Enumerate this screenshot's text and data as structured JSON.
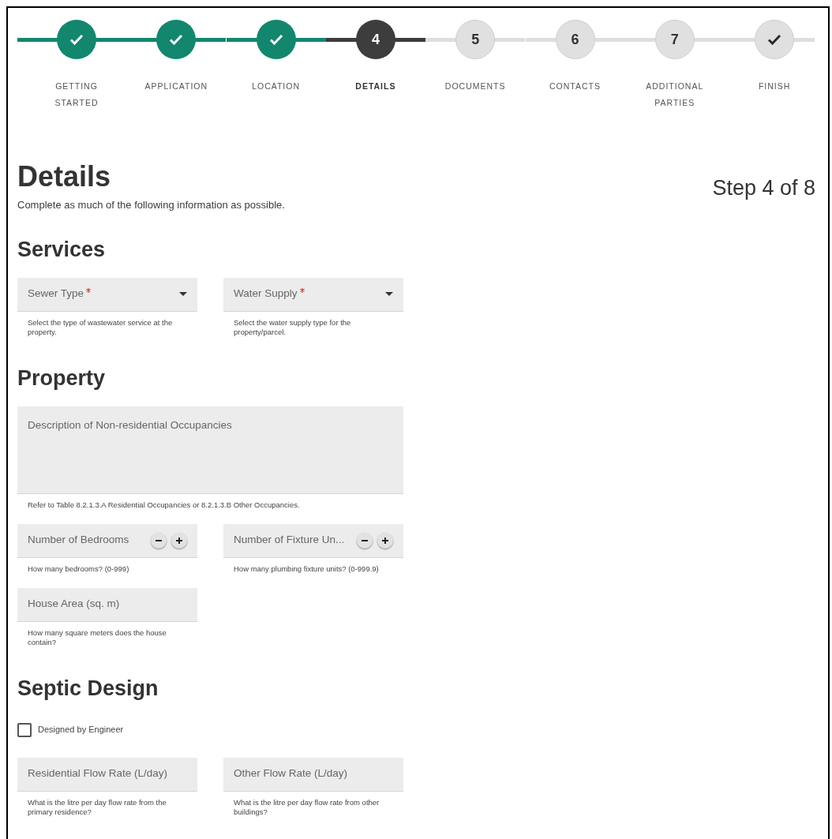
{
  "steps": [
    {
      "label": "GETTING STARTED",
      "completed": true,
      "selected": false
    },
    {
      "label": "APPLICATION",
      "completed": true,
      "selected": false
    },
    {
      "label": "LOCATION",
      "completed": true,
      "selected": false
    },
    {
      "label": "DETAILS",
      "completed": false,
      "selected": true,
      "number": "4"
    },
    {
      "label": "DOCUMENTS",
      "completed": false,
      "selected": false,
      "number": "5"
    },
    {
      "label": "CONTACTS",
      "completed": false,
      "selected": false,
      "number": "6"
    },
    {
      "label": "ADDITIONAL PARTIES",
      "completed": false,
      "selected": false,
      "number": "7"
    },
    {
      "label": "FINISH",
      "completed": false,
      "selected": false
    }
  ],
  "page": {
    "title": "Details",
    "subtitle": "Complete as much of the following information as possible.",
    "step_indicator": "Step 4 of 8"
  },
  "sections": [
    {
      "title": "Services",
      "fields": [
        {
          "kind": "select",
          "label": "Sewer Type",
          "required": true,
          "helper": "Select the type of wastewater service at the property."
        },
        {
          "kind": "select",
          "label": "Water Supply",
          "required": true,
          "helper": "Select the water supply type for the property/parcel."
        }
      ]
    },
    {
      "title": "Property",
      "fields": [
        {
          "kind": "textarea",
          "label": "Description of Non-residential Occupancies",
          "required": false,
          "helper": "Refer to Table 8.2.1.3.A Residential Occupancies or 8.2.1.3.B Other Occupancies."
        },
        {
          "kind": "number",
          "label": "Number of Bedrooms",
          "required": false,
          "helper": "How many bedrooms? (0-999)"
        },
        {
          "kind": "number",
          "label": "Number of Fixture Un...",
          "required": false,
          "helper": "How many plumbing fixture units? (0-999.9)"
        },
        {
          "kind": "text",
          "label": "House Area (sq. m)",
          "required": false,
          "helper": "How many square meters does the house contain?"
        }
      ]
    },
    {
      "title": "Septic Design",
      "fields": [
        {
          "kind": "checkbox",
          "label": "Designed by Engineer",
          "checked": false
        },
        {
          "kind": "text",
          "label": "Residential Flow Rate (L/day)",
          "required": false,
          "helper": "What is the litre per day flow rate from the primary residence?"
        },
        {
          "kind": "text",
          "label": "Other Flow Rate (L/day)",
          "required": false,
          "helper": "What is the litre per day flow rate from other buildings?"
        }
      ]
    }
  ]
}
